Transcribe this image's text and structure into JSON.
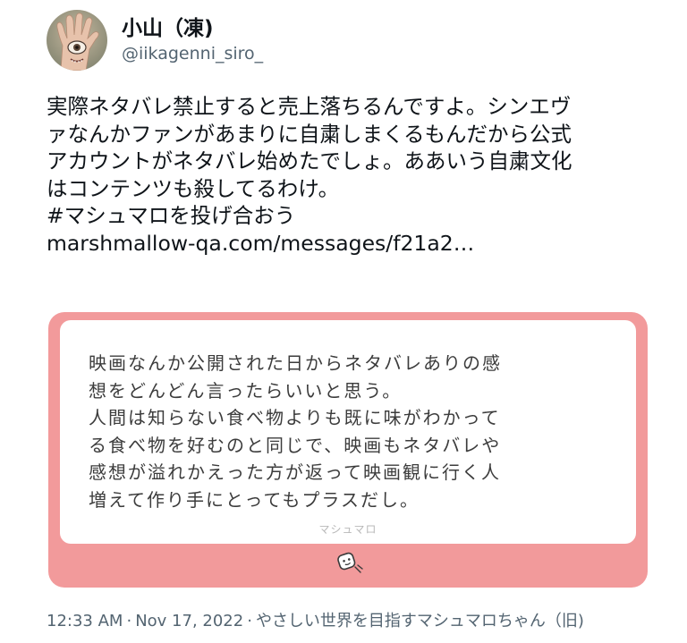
{
  "user": {
    "display_name": "小山（凍)",
    "username": "@iikagenni_siro_"
  },
  "tweet": {
    "lines": [
      "実際ネタバレ禁止すると売上落ちるんですよ。シンエヴ",
      "ァなんかファンがあまりに自粛しまくるもんだから公式",
      "アカウントがネタバレ始めたでしょ。ああいう自粛文化",
      "はコンテンツも殺してるわけ。",
      "#マシュマロを投げ合おう",
      "marshmallow-qa.com/messages/f21a2…"
    ]
  },
  "card": {
    "lines": [
      "映画なんか公開された日からネタバレありの感",
      "想をどんどん言ったらいいと思う。",
      "人間は知らない食べ物よりも既に味がわかって",
      "る食べ物を好むのと同じで、映画もネタバレや",
      "感想が溢れかえった方が返って映画観に行く人",
      "増えて作り手にとってもプラスだし。"
    ],
    "brand": "マシュマロ",
    "logo_icon": "marshmallow-icon",
    "colors": {
      "frame": "#f29a9b",
      "text": "#3c3c3c"
    }
  },
  "footer": {
    "time": "12:33 AM",
    "date": "Nov 17, 2022",
    "source": "やさしい世界を目指すマシュマロちゃん（旧)",
    "separator": "·"
  },
  "colors": {
    "text": "#0f1419",
    "secondary": "#536471"
  }
}
